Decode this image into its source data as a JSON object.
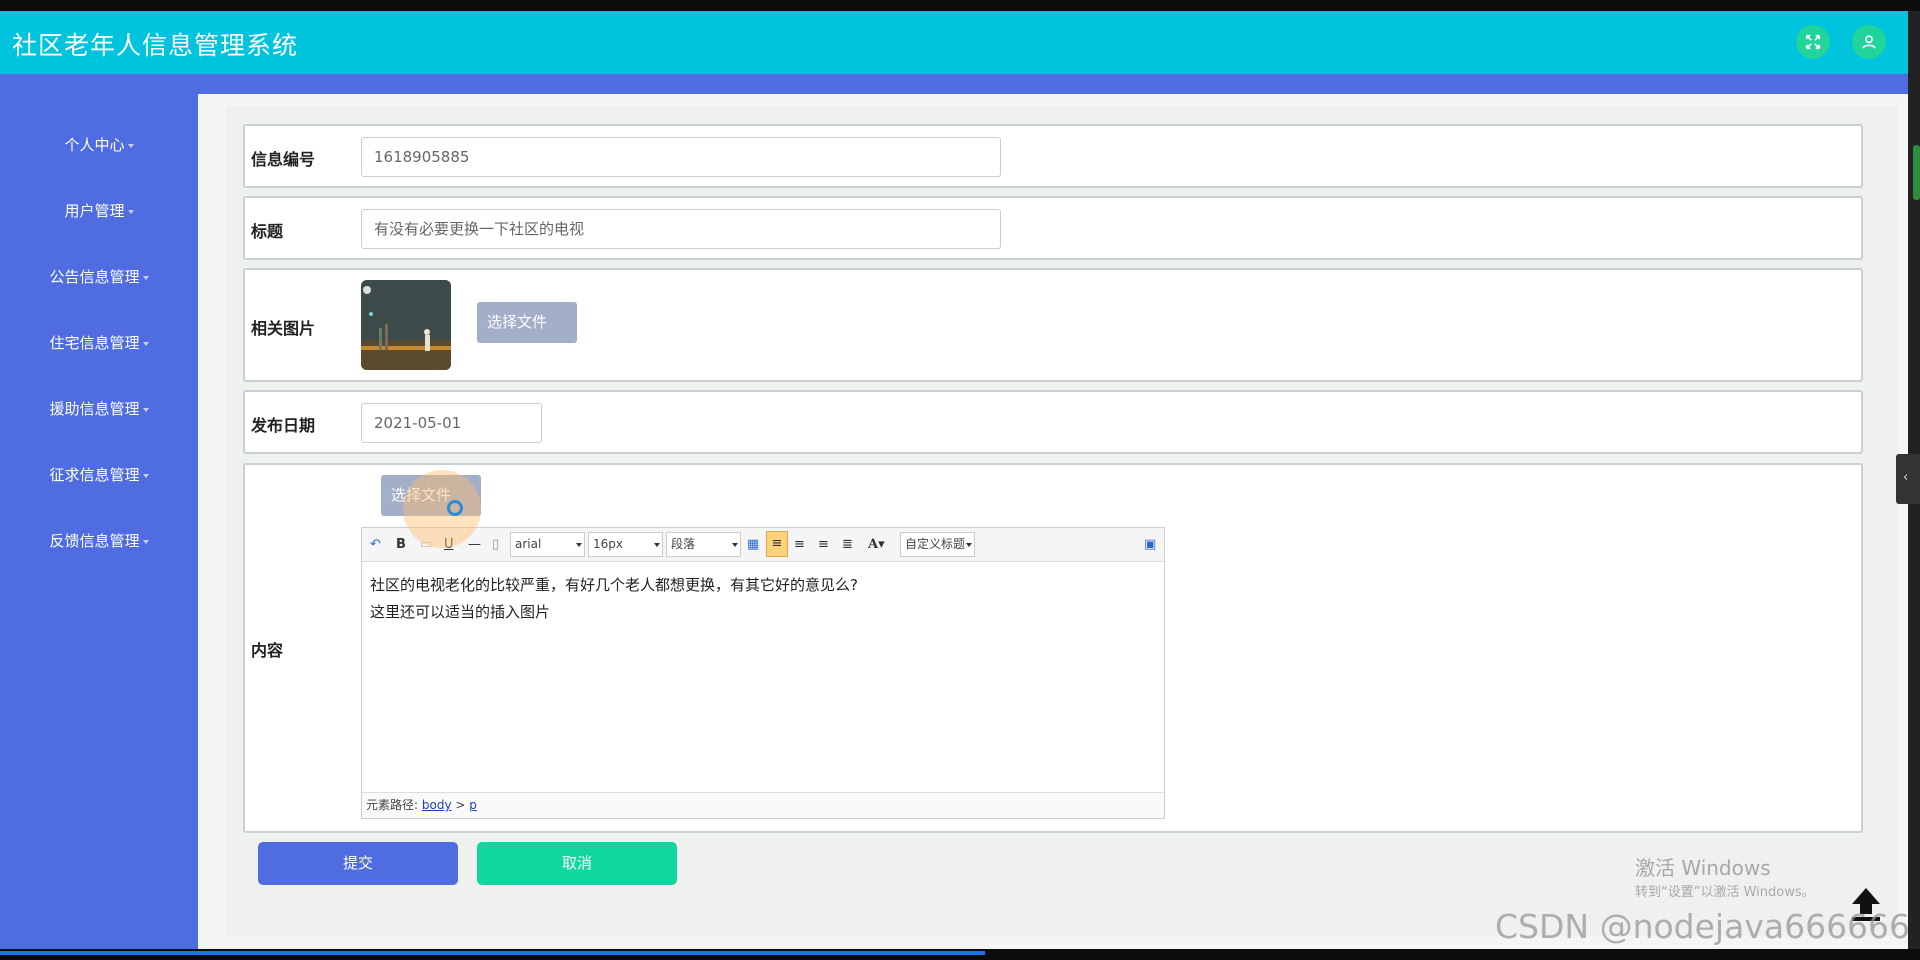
{
  "app": {
    "title": "社区老年人信息管理系统"
  },
  "header": {
    "fullscreen_icon": "fullscreen-icon",
    "user_icon": "user-icon"
  },
  "sidebar": {
    "items": [
      {
        "label": "个人中心"
      },
      {
        "label": "用户管理"
      },
      {
        "label": "公告信息管理"
      },
      {
        "label": "住宅信息管理"
      },
      {
        "label": "援助信息管理"
      },
      {
        "label": "征求信息管理"
      },
      {
        "label": "反馈信息管理"
      }
    ]
  },
  "form": {
    "info_no": {
      "label": "信息编号",
      "value": "1618905885"
    },
    "title": {
      "label": "标题",
      "value": "有没有必要更换一下社区的电视"
    },
    "image": {
      "label": "相关图片",
      "button": "选择文件"
    },
    "date": {
      "label": "发布日期",
      "value": "2021-05-01"
    },
    "content": {
      "label": "内容",
      "upload_button": "选择文件",
      "toolbar": {
        "font_family": "arial",
        "font_size": "16px",
        "paragraph": "段落",
        "custom_title": "自定义标题"
      },
      "body_lines": [
        "社区的电视老化的比较严重，有好几个老人都想更换，有其它好的意见么?",
        "这里还可以适当的插入图片"
      ],
      "path_label": "元素路径:",
      "path_body": "body",
      "path_sep": ">",
      "path_p": "p"
    }
  },
  "actions": {
    "submit": "提交",
    "cancel": "取消"
  },
  "overlay": {
    "activate_title": "激活 Windows",
    "activate_sub": "转到“设置”以激活 Windows。",
    "watermark": "CSDN @nodejava666666"
  },
  "colors": {
    "header": "#00c4de",
    "sidebar": "#4f6de0",
    "submit": "#4f6de0",
    "cancel": "#12d6a0"
  }
}
